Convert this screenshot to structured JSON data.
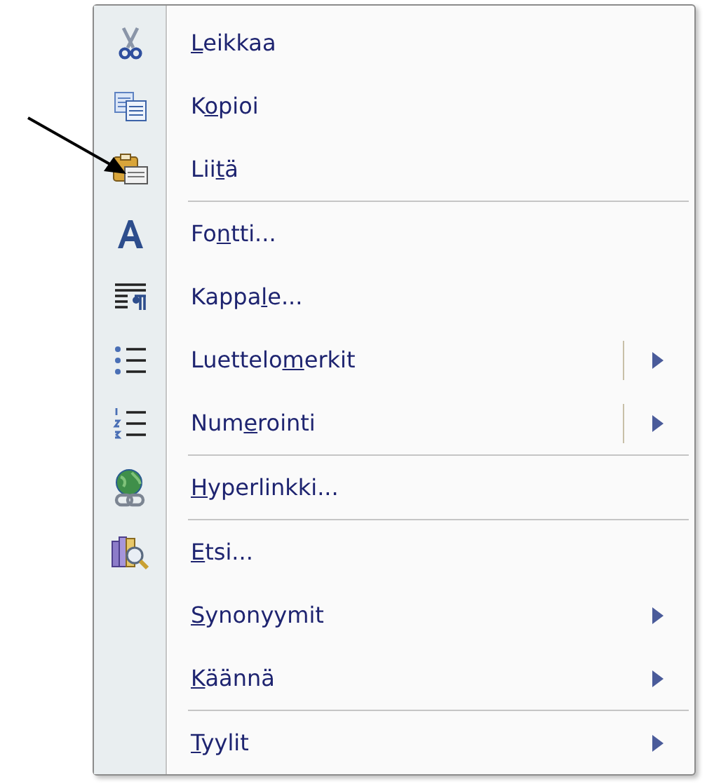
{
  "context_menu": {
    "groups": [
      {
        "items": [
          {
            "access_key": "L",
            "label_after": "eikkaa",
            "submenu": false,
            "split_button": false
          },
          {
            "label_before": "K",
            "access_key": "o",
            "label_after": "pioi",
            "submenu": false,
            "split_button": false
          },
          {
            "label_before": "Lii",
            "access_key": "t",
            "label_after": "ä",
            "submenu": false,
            "split_button": false
          }
        ]
      },
      {
        "items": [
          {
            "label_before": "Fo",
            "access_key": "n",
            "label_after": "tti...",
            "submenu": false,
            "split_button": false
          },
          {
            "label_before": "Kappa",
            "access_key": "l",
            "label_after": "e...",
            "submenu": false,
            "split_button": false
          },
          {
            "label_before": "Luettelo",
            "access_key": "m",
            "label_after": "erkit",
            "submenu": true,
            "split_button": true
          },
          {
            "label_before": "Num",
            "access_key": "e",
            "label_after": "rointi",
            "submenu": true,
            "split_button": true
          }
        ]
      },
      {
        "items": [
          {
            "access_key": "H",
            "label_after": "yperlinkki...",
            "submenu": false,
            "split_button": false
          }
        ]
      },
      {
        "items": [
          {
            "access_key": "E",
            "label_after": "tsi...",
            "submenu": false,
            "split_button": false
          },
          {
            "access_key": "S",
            "label_after": "ynonyymit",
            "submenu": true,
            "split_button": false
          },
          {
            "access_key": "K",
            "label_after": "äännä",
            "submenu": true,
            "split_button": false
          }
        ]
      },
      {
        "items": [
          {
            "access_key": "T",
            "label_after": "yylit",
            "submenu": true,
            "split_button": false
          }
        ]
      }
    ]
  }
}
